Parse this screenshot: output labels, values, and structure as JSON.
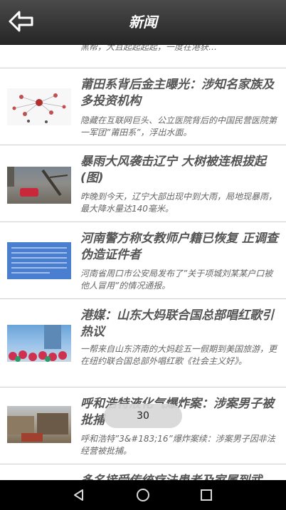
{
  "header": {
    "title": "新闻",
    "back_icon": "back-arrow-icon"
  },
  "feed": {
    "partial_top": "黑帮，大且起起起起，一度在港获…",
    "items": [
      {
        "title": "莆田系背后金主曝光：涉知名家族及多投资机构",
        "desc": "隐藏在互联网巨头、公立医院背后的中国民营医院第一军团”莆田系”，浮出水面。"
      },
      {
        "title": "暴雨大风袭击辽宁 大树被连根拔起(图)",
        "desc": "昨晚到今天，辽宁大部出现中到大雨，局地现暴雨，最大降水量达140毫米。"
      },
      {
        "title": "河南警方称女教师户籍已恢复 正调查伪造证件者",
        "desc": "河南省周口市公安局发布了”关于项城刘某某户口被他人冒用”的情况通报。"
      },
      {
        "title": "港媒：山东大妈联合国总部唱红歌引热议",
        "desc": "一帮来自山东济南的大妈趁五一假期到美国旅游，更在纽约联合国总部外唱红歌《社会主义好》。"
      },
      {
        "title": "呼和浩特液化气爆炸案：涉案男子被批捕",
        "desc": "呼和浩特”3&#183;16”爆炸案续：涉案男子因非法经营被批捕。"
      },
      {
        "title": "多名接受传统疗法患者及家属到武",
        "desc": ""
      }
    ]
  },
  "page_indicator": "30",
  "navbar": {
    "back": "nav-back-icon",
    "home": "nav-home-icon",
    "recents": "nav-recents-icon"
  }
}
